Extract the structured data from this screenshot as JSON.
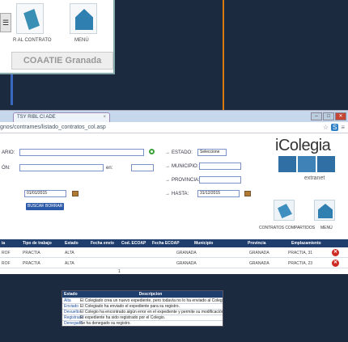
{
  "inset": {
    "menu_glyph": "☰",
    "contract_label": "R AL CONTRATO",
    "menu_label": "MENÚ",
    "brand": "COAATIE Granada"
  },
  "browser": {
    "tab_title": "TSY RIBL CI ADE",
    "tab_close": "×",
    "url": "gnos/contrames/listado_contratos_col.asp",
    "window_controls": [
      "–",
      "□",
      "✕"
    ],
    "address_icons": [
      "☆",
      "S",
      "≡"
    ]
  },
  "form": {
    "label_left1": "ARIO:",
    "label_left2": "ÓN:",
    "label_mid": "en:",
    "estado_label": "ESTADO:",
    "estado_value": "Seleccione",
    "municipio_label": "MUNICIPIO:",
    "provincia_label": "PROVINCIA:",
    "hasta_label": "HASTA:",
    "hasta_value": "31/12/2015",
    "desde_value": "01/01/2015",
    "buscar_label": "BUSCAR",
    "borrar_label": "BORRAR",
    "arrow_prefix": "→"
  },
  "header": {
    "logo": "iColegia",
    "sub": "extranet"
  },
  "tiles": {
    "contratos_label": "CONTRATOS COMPARTIDOS",
    "menu_label": "MENÚ"
  },
  "table": {
    "columns": [
      "ia",
      "Tipo de trabajo",
      "Estado",
      "Fecha envío",
      "Cod. ECOAP",
      "Fecha ECOAP",
      "Municipio",
      "Provincia",
      "Emplazamiento"
    ],
    "rows": [
      [
        "ROF",
        "PRACTIA",
        "ALTA",
        "",
        "",
        "",
        "GRANADA",
        "GRANADA",
        "PRACTIA, 31"
      ],
      [
        "ROF",
        "PRACTIA",
        "ALTA",
        "",
        "",
        "",
        "GRANADA",
        "GRANADA",
        "PRACTIA, 23"
      ]
    ],
    "delete_glyph": "✕",
    "page": "1"
  },
  "legend": {
    "col1": "Estado",
    "col2": "Descripcion",
    "rows": [
      {
        "estado": "Alta",
        "desc": "El Colegiado crea un nuevo expediente, pero todavía no lo ha enviado al Colegio."
      },
      {
        "estado": "Enviado",
        "desc": "El Colegiado ha enviado el expediente para su registro."
      },
      {
        "estado": "Devuelto",
        "desc": "El Colegio ha encontrado algún error en el expediente y permite su modificación."
      },
      {
        "estado": "Registrado",
        "desc": "El expediente ha sido registrado por el Colegio."
      },
      {
        "estado": "Denegado",
        "desc": "Se ha denegado su registro."
      }
    ]
  },
  "colors": {
    "arrow": "#d77a12",
    "table_header": "#1f3e6d",
    "background": "#1b2a3f",
    "delete": "#cc2a22"
  }
}
